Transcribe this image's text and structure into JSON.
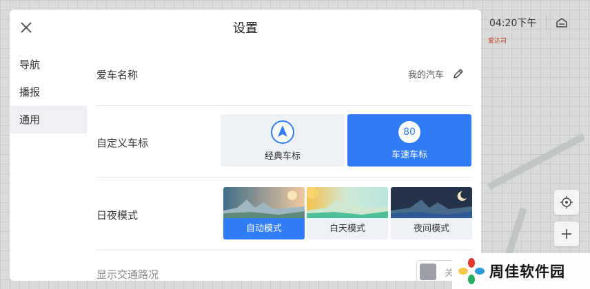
{
  "map": {
    "time": "04:20下午",
    "sub_label": "爱达司",
    "icons": {
      "home": "home-icon",
      "locate": "locate-icon",
      "zoom_in": "plus-icon"
    }
  },
  "panel": {
    "title": "设置",
    "close_icon": "close-icon"
  },
  "sidebar": {
    "items": [
      {
        "label": "导航",
        "active": false
      },
      {
        "label": "播报",
        "active": false
      },
      {
        "label": "通用",
        "active": true
      }
    ]
  },
  "settings": {
    "car_name": {
      "label": "爱车名称",
      "value": "我的汽车",
      "edit_icon": "pencil-icon"
    },
    "car_icon": {
      "label": "自定义车标",
      "options": [
        {
          "label": "经典车标",
          "icon": "navigation-arrow-icon",
          "selected": false
        },
        {
          "label": "车速车标",
          "badge": "80",
          "selected": true
        }
      ]
    },
    "day_night": {
      "label": "日夜模式",
      "options": [
        {
          "label": "自动模式",
          "selected": true
        },
        {
          "label": "白天模式",
          "selected": false
        },
        {
          "label": "夜间模式",
          "selected": false
        }
      ]
    },
    "traffic": {
      "label": "显示交通路况",
      "toggle_text": "关"
    }
  },
  "colors": {
    "accent": "#2f7cf6",
    "card_bg": "#eef1f5"
  },
  "watermark": {
    "text": "周佳软件园"
  }
}
